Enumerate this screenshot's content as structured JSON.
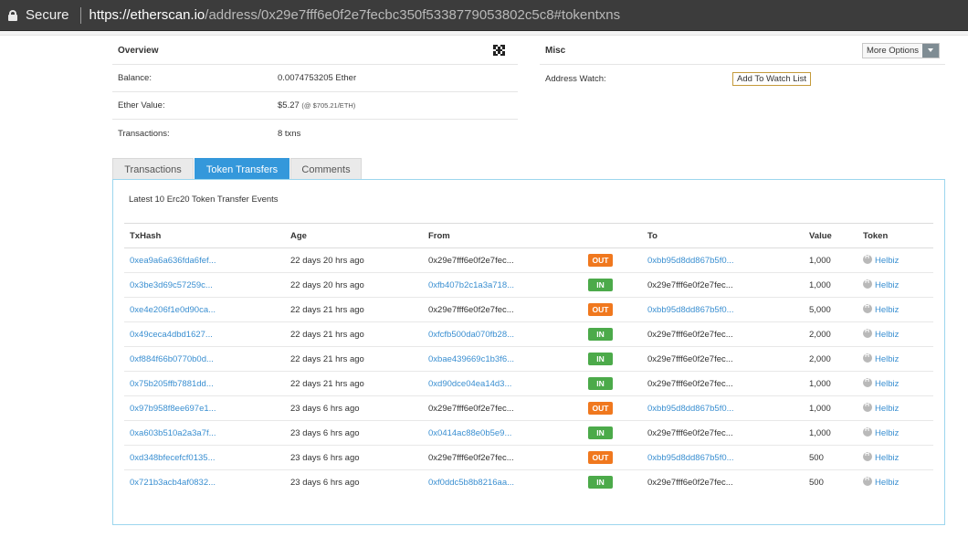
{
  "browser": {
    "secure_label": "Secure",
    "url_host": "https://etherscan.io",
    "url_path": "/address/0x29e7fff6e0f2e7fecbc350f5338779053802c5c8#tokentxns"
  },
  "overview": {
    "title": "Overview",
    "rows": [
      {
        "label": "Balance:",
        "value": "0.0074753205 Ether",
        "extra": ""
      },
      {
        "label": "Ether Value:",
        "value": "$5.27",
        "extra": "(@ $705.21/ETH)"
      },
      {
        "label": "Transactions:",
        "value": "8 txns",
        "extra": ""
      }
    ]
  },
  "misc": {
    "title": "Misc",
    "more_options_label": "More Options",
    "address_watch_label": "Address Watch:",
    "watch_button_label": "Add To Watch List"
  },
  "tabs": [
    {
      "label": "Transactions",
      "active": false
    },
    {
      "label": "Token Transfers",
      "active": true
    },
    {
      "label": "Comments",
      "active": false
    }
  ],
  "content": {
    "title": "Latest 10 Erc20 Token Transfer Events",
    "columns": [
      "TxHash",
      "Age",
      "From",
      "",
      "To",
      "Value",
      "Token"
    ],
    "rows": [
      {
        "hash": "0xea9a6a636fda6fef...",
        "age": "22 days 20 hrs ago",
        "from": "0x29e7fff6e0f2e7fec...",
        "from_link": false,
        "dir": "OUT",
        "to": "0xbb95d8dd867b5f0...",
        "to_link": true,
        "value": "1,000",
        "token": "Helbiz"
      },
      {
        "hash": "0x3be3d69c57259c...",
        "age": "22 days 20 hrs ago",
        "from": "0xfb407b2c1a3a718...",
        "from_link": true,
        "dir": "IN",
        "to": "0x29e7fff6e0f2e7fec...",
        "to_link": false,
        "value": "1,000",
        "token": "Helbiz"
      },
      {
        "hash": "0xe4e206f1e0d90ca...",
        "age": "22 days 21 hrs ago",
        "from": "0x29e7fff6e0f2e7fec...",
        "from_link": false,
        "dir": "OUT",
        "to": "0xbb95d8dd867b5f0...",
        "to_link": true,
        "value": "5,000",
        "token": "Helbiz"
      },
      {
        "hash": "0x49ceca4dbd1627...",
        "age": "22 days 21 hrs ago",
        "from": "0xfcfb500da070fb28...",
        "from_link": true,
        "dir": "IN",
        "to": "0x29e7fff6e0f2e7fec...",
        "to_link": false,
        "value": "2,000",
        "token": "Helbiz"
      },
      {
        "hash": "0xf884f66b0770b0d...",
        "age": "22 days 21 hrs ago",
        "from": "0xbae439669c1b3f6...",
        "from_link": true,
        "dir": "IN",
        "to": "0x29e7fff6e0f2e7fec...",
        "to_link": false,
        "value": "2,000",
        "token": "Helbiz"
      },
      {
        "hash": "0x75b205ffb7881dd...",
        "age": "22 days 21 hrs ago",
        "from": "0xd90dce04ea14d3...",
        "from_link": true,
        "dir": "IN",
        "to": "0x29e7fff6e0f2e7fec...",
        "to_link": false,
        "value": "1,000",
        "token": "Helbiz"
      },
      {
        "hash": "0x97b958f8ee697e1...",
        "age": "23 days 6 hrs ago",
        "from": "0x29e7fff6e0f2e7fec...",
        "from_link": false,
        "dir": "OUT",
        "to": "0xbb95d8dd867b5f0...",
        "to_link": true,
        "value": "1,000",
        "token": "Helbiz"
      },
      {
        "hash": "0xa603b510a2a3a7f...",
        "age": "23 days 6 hrs ago",
        "from": "0x0414ac88e0b5e9...",
        "from_link": true,
        "dir": "IN",
        "to": "0x29e7fff6e0f2e7fec...",
        "to_link": false,
        "value": "1,000",
        "token": "Helbiz"
      },
      {
        "hash": "0xd348bfecefcf0135...",
        "age": "23 days 6 hrs ago",
        "from": "0x29e7fff6e0f2e7fec...",
        "from_link": false,
        "dir": "OUT",
        "to": "0xbb95d8dd867b5f0...",
        "to_link": true,
        "value": "500",
        "token": "Helbiz"
      },
      {
        "hash": "0x721b3acb4af0832...",
        "age": "23 days 6 hrs ago",
        "from": "0xf0ddc5b8b8216aa...",
        "from_link": true,
        "dir": "IN",
        "to": "0x29e7fff6e0f2e7fec...",
        "to_link": false,
        "value": "500",
        "token": "Helbiz"
      }
    ]
  },
  "colors": {
    "accent": "#3498db",
    "link": "#3a8fd1",
    "out_badge": "#f0781e",
    "in_badge": "#4caa4a",
    "content_border": "#9cd6ee"
  }
}
